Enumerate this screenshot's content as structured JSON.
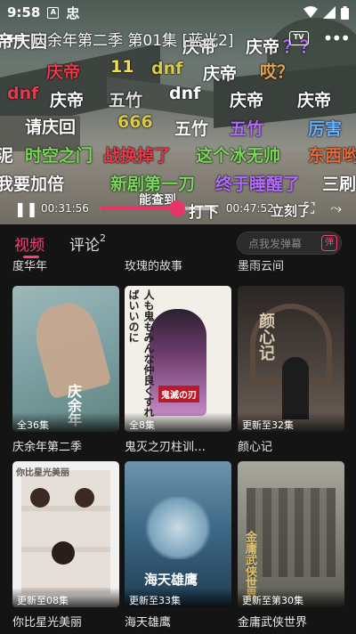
{
  "status_bar": {
    "time": "9:58",
    "note_icon": "A",
    "app_char": "忠"
  },
  "video": {
    "title": "庆余年第二季 第01集 [蓝光2]",
    "tv_label": "TV",
    "current_time": "00:31:56",
    "total_time": "00:47:52",
    "progress_percent": 67
  },
  "danmaku": [
    {
      "text": "帝庆回",
      "color": "#ffffff"
    },
    {
      "text": "庆帝",
      "color": "#ffffff"
    },
    {
      "text": "庆帝",
      "color": "#ffffff"
    },
    {
      "text": "？？",
      "color": "#b36bff"
    },
    {
      "text": "庆帝",
      "color": "#e83a4a"
    },
    {
      "text": "11",
      "color": "#f0e050"
    },
    {
      "text": "dnf",
      "color": "#d9c84a"
    },
    {
      "text": "庆帝",
      "color": "#ffffff"
    },
    {
      "text": "哎？",
      "color": "#e8a24a"
    },
    {
      "text": "dnf",
      "color": "#e83a4a"
    },
    {
      "text": "庆帝",
      "color": "#ffffff"
    },
    {
      "text": "五竹",
      "color": "#ffffff"
    },
    {
      "text": "dnf",
      "color": "#ffffff"
    },
    {
      "text": "庆帝",
      "color": "#ffffff"
    },
    {
      "text": "庆帝",
      "color": "#ffffff"
    },
    {
      "text": "请庆回",
      "color": "#ffffff"
    },
    {
      "text": "666",
      "color": "#d9c84a"
    },
    {
      "text": "五竹",
      "color": "#ffffff"
    },
    {
      "text": "五竹",
      "color": "#b36bff"
    },
    {
      "text": "厉害",
      "color": "#6bb0ff"
    },
    {
      "text": "泥",
      "color": "#ffffff"
    },
    {
      "text": "时空之门",
      "color": "#7ad95a"
    },
    {
      "text": "战换掉了",
      "color": "#e83a4a"
    },
    {
      "text": "这个冰无帅",
      "color": "#7ad95a"
    },
    {
      "text": "东西哟",
      "color": "#e86a3a"
    },
    {
      "text": "我要加倍",
      "color": "#ffffff"
    },
    {
      "text": "新剧第一刀",
      "color": "#7ad95a"
    },
    {
      "text": "终于睡醒了",
      "color": "#b36bff"
    },
    {
      "text": "三刷",
      "color": "#ffffff"
    },
    {
      "text": "能查到",
      "color": "#ffffff"
    },
    {
      "text": "打下",
      "color": "#ffffff"
    },
    {
      "text": "立刻了",
      "color": "#ffffff"
    }
  ],
  "tabs": [
    {
      "label": "视频",
      "active": true
    },
    {
      "label": "评论",
      "count": "2",
      "active": false
    }
  ],
  "danmu_input": {
    "placeholder": "点我发弹幕",
    "button_label": "弹"
  },
  "prev_row_titles": [
    "度华年",
    "玫瑰的故事",
    "墨雨云间"
  ],
  "cards": [
    {
      "title": "庆余年第二季",
      "badge": "全36集",
      "art": "庆余年",
      "art2": "",
      "bg": "#7fa3a6"
    },
    {
      "title": "鬼灭之刃柱训…",
      "badge": "全8集",
      "art": "人も鬼もみんな仲良くすればいいのに",
      "art2": "鬼滅の刃",
      "bg": "#f1efe8"
    },
    {
      "title": "颜心记",
      "badge": "更新至32集",
      "art": "颜心记",
      "art2": "",
      "bg": "#3a3432"
    },
    {
      "title": "你比星光美丽",
      "badge": "更新至08集",
      "art": "你比星光美丽",
      "art2": "",
      "bg": "#f3f1ef"
    },
    {
      "title": "海天雄鹰",
      "badge": "更新至33集",
      "art": "海天雄鹰",
      "art2": "",
      "bg": "#3f6a86"
    },
    {
      "title": "金庸武侠世界",
      "badge": "更新至第30集",
      "art": "金庸武侠世界",
      "art2": "",
      "bg": "#8a8a80"
    }
  ],
  "colors": {
    "accent": "#fa3f73",
    "progress": "#e8346a",
    "background": "#141414"
  },
  "icons": [
    "back-arrow-icon",
    "tv-cast-icon",
    "more-icon",
    "play-pause-icon",
    "fullscreen-icon",
    "next-icon",
    "wifi-icon",
    "signal-icon",
    "battery-icon"
  ]
}
